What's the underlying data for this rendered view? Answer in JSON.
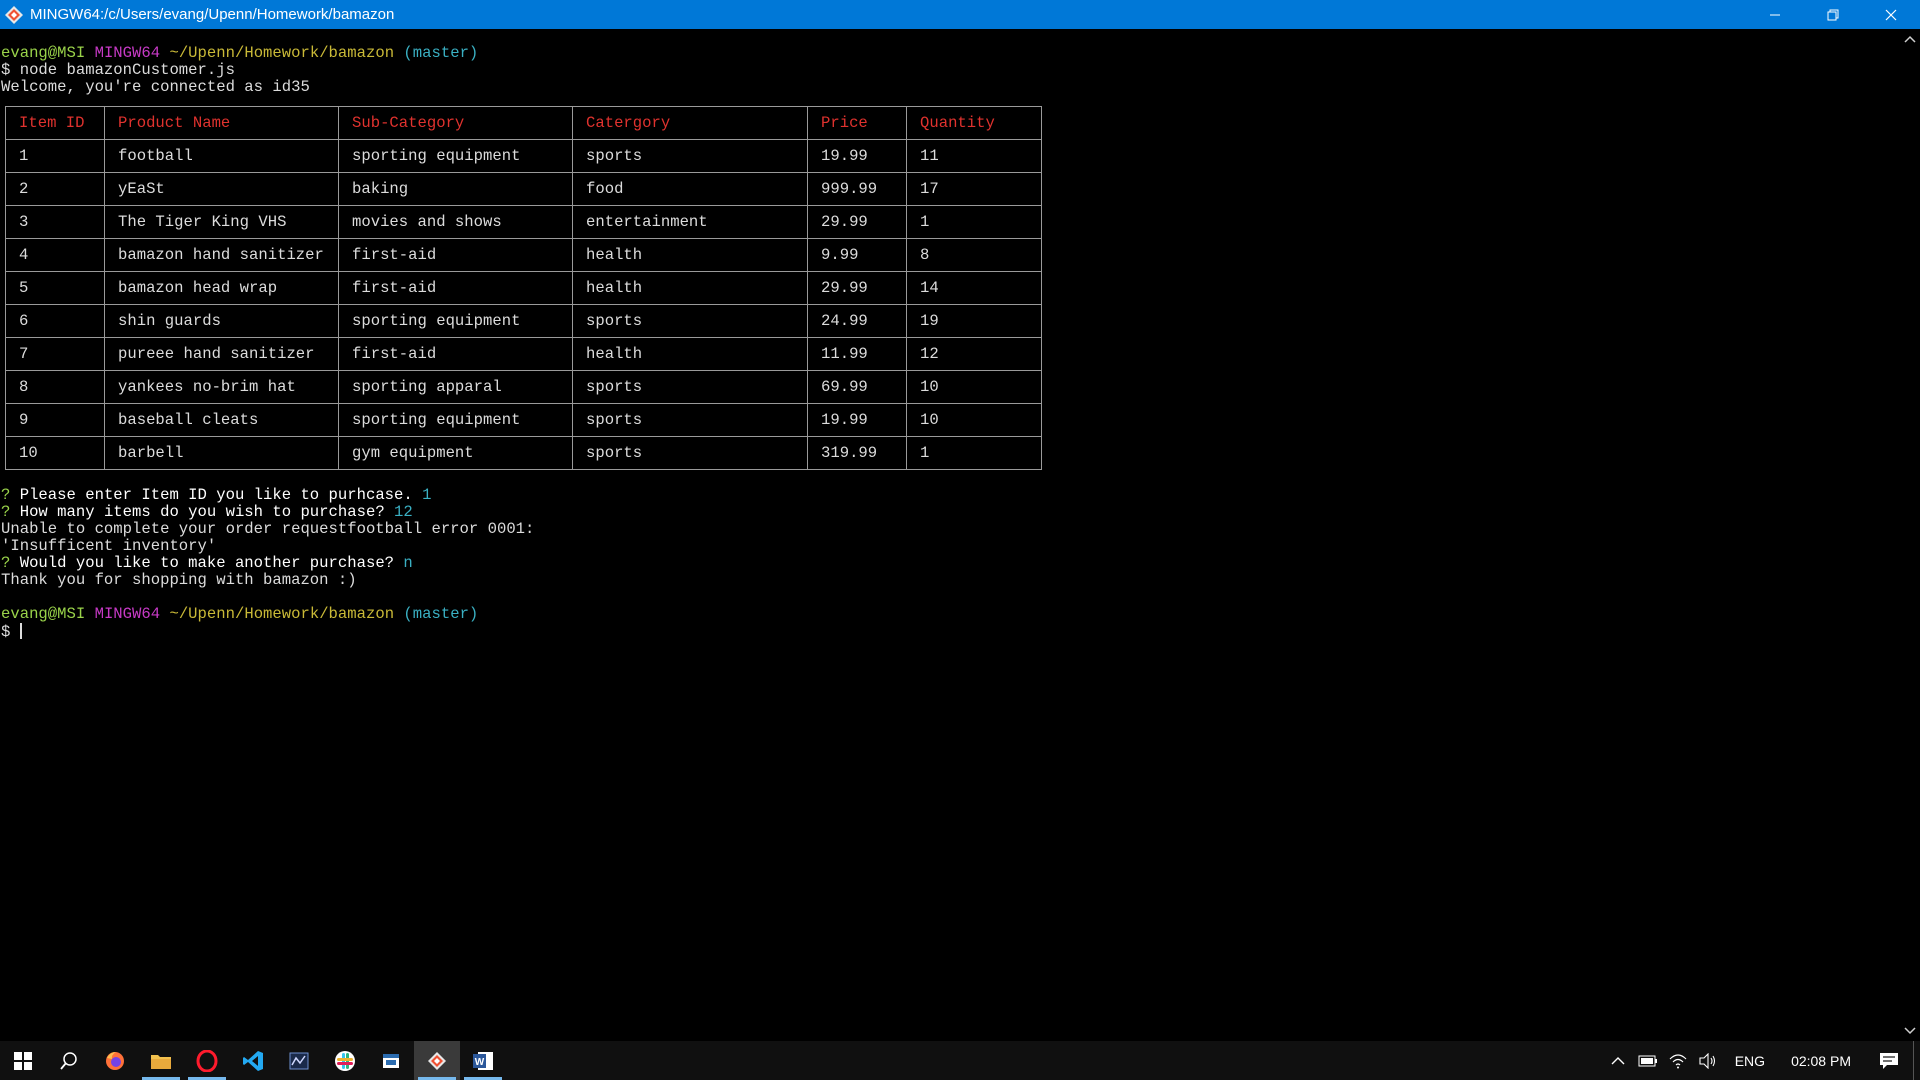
{
  "window": {
    "title": "MINGW64:/c/Users/evang/Upenn/Homework/bamazon",
    "minimize_icon": "minimize-icon",
    "restore_icon": "restore-icon",
    "close_icon": "close-icon"
  },
  "terminal": {
    "prompt1": {
      "user": "evang@MSI",
      "shell": "MINGW64",
      "path": "~/Upenn/Homework/bamazon",
      "branch": "(master)"
    },
    "command": "$ node bamazonCustomer.js",
    "welcome": "Welcome, you're connected as id35",
    "table": {
      "headers": [
        "Item ID",
        "Product Name",
        "Sub-Category",
        "Catergory",
        "Price",
        "Quantity"
      ],
      "rows": [
        [
          "1",
          "football",
          "sporting equipment",
          "sports",
          "19.99",
          "11"
        ],
        [
          "2",
          "yEaSt",
          "baking",
          "food",
          "999.99",
          "17"
        ],
        [
          "3",
          "The Tiger King VHS",
          "movies and shows",
          "entertainment",
          "29.99",
          "1"
        ],
        [
          "4",
          "bamazon hand sanitizer",
          "first-aid",
          "health",
          "9.99",
          "8"
        ],
        [
          "5",
          "bamazon head wrap",
          "first-aid",
          "health",
          "29.99",
          "14"
        ],
        [
          "6",
          "shin guards",
          "sporting equipment",
          "sports",
          "24.99",
          "19"
        ],
        [
          "7",
          "pureee hand sanitizer",
          "first-aid",
          "health",
          "11.99",
          "12"
        ],
        [
          "8",
          "yankees no-brim hat",
          "sporting apparal",
          "sports",
          "69.99",
          "10"
        ],
        [
          "9",
          "baseball cleats",
          "sporting equipment",
          "sports",
          "19.99",
          "10"
        ],
        [
          "10",
          "barbell",
          "gym equipment",
          "sports",
          "319.99",
          "1"
        ]
      ]
    },
    "q1": {
      "mark": "?",
      "text": "Please enter Item ID you like to purhcase.",
      "answer": "1"
    },
    "q2": {
      "mark": "?",
      "text": "How many items do you wish to purchase?",
      "answer": "12"
    },
    "error_line1": "Unable to complete your order requestfootball error 0001:",
    "error_line2": "'Insufficent inventory'",
    "q3": {
      "mark": "?",
      "text": "Would you like to make another purchase?",
      "answer": "n"
    },
    "thanks": "Thank you for shopping with bamazon :)",
    "prompt2": {
      "user": "evang@MSI",
      "shell": "MINGW64",
      "path": "~/Upenn/Homework/bamazon",
      "branch": "(master)"
    },
    "final_prompt": "$ "
  },
  "taskbar": {
    "apps": [
      "start-icon",
      "search-icon",
      "firefox-icon",
      "file-explorer-icon",
      "opera-icon",
      "vscode-icon",
      "git-gui-icon",
      "slack-icon",
      "calendar-app-icon",
      "git-bash-icon",
      "word-icon"
    ],
    "language": "ENG",
    "time": "02:08 PM"
  },
  "colors": {
    "titlebar": "#0078d7",
    "header_red": "#e0322e",
    "prompt_green": "#9ad34a",
    "prompt_magenta": "#c73ac6",
    "prompt_yellow": "#c9b937",
    "prompt_cyan": "#3ab0c3"
  }
}
